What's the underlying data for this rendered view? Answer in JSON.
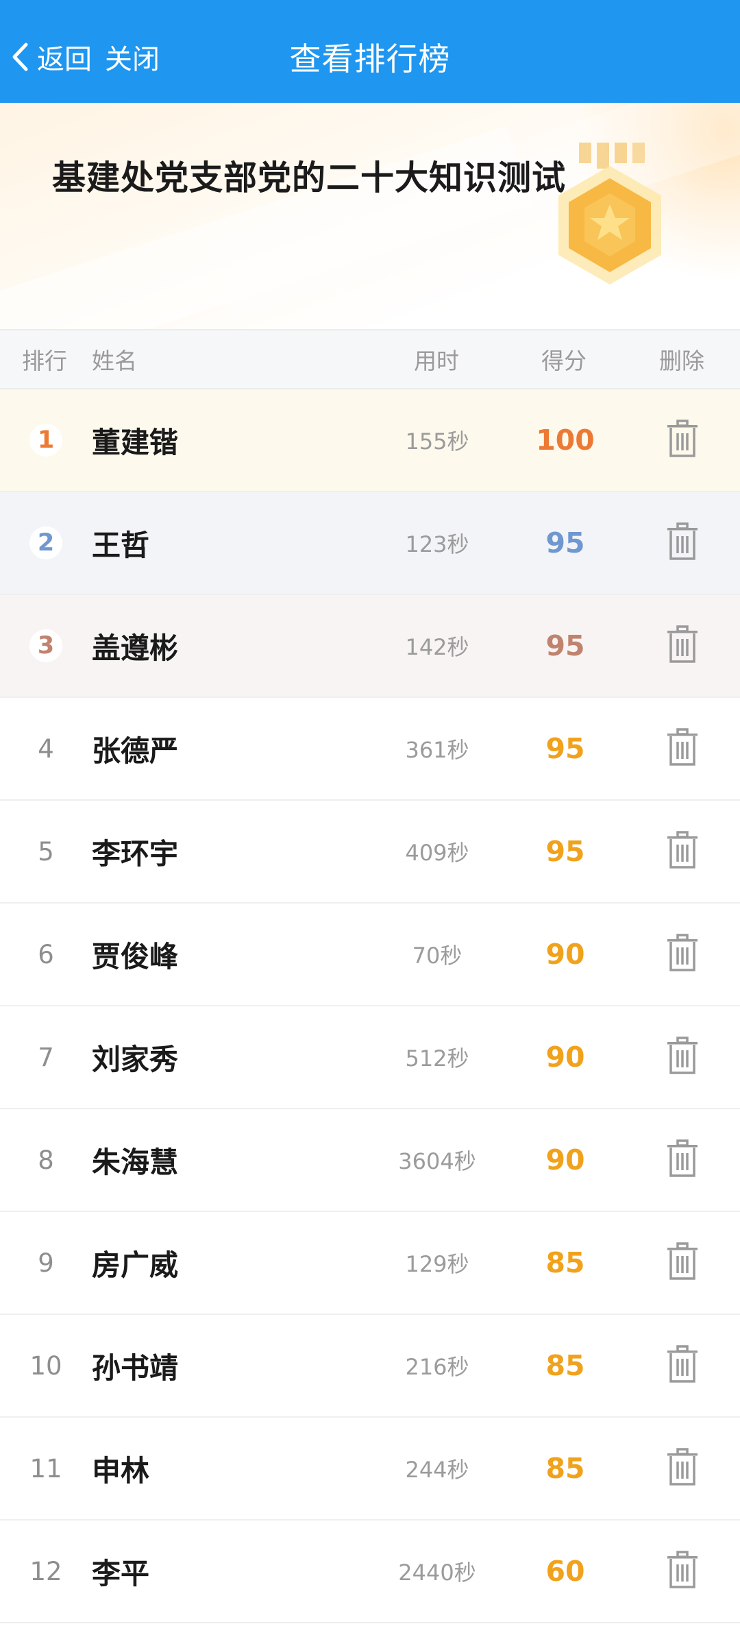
{
  "nav": {
    "back_label": "返回",
    "close_label": "关闭",
    "title": "查看排行榜"
  },
  "banner": {
    "title": "基建处党支部党的二十大知识测试"
  },
  "columns": {
    "rank": "排行",
    "name": "姓名",
    "time": "用时",
    "score": "得分",
    "delete": "删除"
  },
  "rows": [
    {
      "rank": "1",
      "name": "董建锴",
      "time": "155秒",
      "score": "100"
    },
    {
      "rank": "2",
      "name": "王哲",
      "time": "123秒",
      "score": "95"
    },
    {
      "rank": "3",
      "name": "盖遵彬",
      "time": "142秒",
      "score": "95"
    },
    {
      "rank": "4",
      "name": "张德严",
      "time": "361秒",
      "score": "95"
    },
    {
      "rank": "5",
      "name": "李环宇",
      "time": "409秒",
      "score": "95"
    },
    {
      "rank": "6",
      "name": "贾俊峰",
      "time": "70秒",
      "score": "90"
    },
    {
      "rank": "7",
      "name": "刘家秀",
      "time": "512秒",
      "score": "90"
    },
    {
      "rank": "8",
      "name": "朱海慧",
      "time": "3604秒",
      "score": "90"
    },
    {
      "rank": "9",
      "name": "房广威",
      "time": "129秒",
      "score": "85"
    },
    {
      "rank": "10",
      "name": "孙书靖",
      "time": "216秒",
      "score": "85"
    },
    {
      "rank": "11",
      "name": "申林",
      "time": "244秒",
      "score": "85"
    },
    {
      "rank": "12",
      "name": "李平",
      "time": "2440秒",
      "score": "60"
    }
  ],
  "colors": {
    "nav_bg": "#1f96f0",
    "gold": "#ec7a35",
    "silver": "#6f97d0",
    "bronze": "#c0836e",
    "score": "#f1a21c"
  },
  "icons": {
    "back": "chevron-left-icon",
    "delete": "trash-icon",
    "medal": "star-medal-icon"
  }
}
